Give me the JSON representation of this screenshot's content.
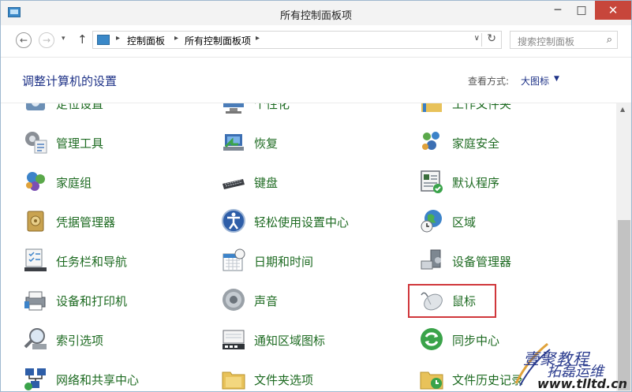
{
  "window": {
    "title": "所有控制面板项",
    "minimize_icon": "minimize-icon",
    "maximize_icon": "maximize-icon",
    "close_icon": "close-icon"
  },
  "navigation": {
    "breadcrumb": [
      "控制面板",
      "所有控制面板项"
    ],
    "search_placeholder": "搜索控制面板"
  },
  "header": {
    "title": "调整计算机的设置",
    "view_label": "查看方式:",
    "view_value": "大图标"
  },
  "items": [
    {
      "label": "定位设置",
      "icon": "location-icon"
    },
    {
      "label": "个性化",
      "icon": "personalization-icon"
    },
    {
      "label": "工作文件夹",
      "icon": "work-folders-icon"
    },
    {
      "label": "管理工具",
      "icon": "admin-tools-icon"
    },
    {
      "label": "恢复",
      "icon": "recovery-icon"
    },
    {
      "label": "家庭安全",
      "icon": "family-safety-icon"
    },
    {
      "label": "家庭组",
      "icon": "homegroup-icon"
    },
    {
      "label": "键盘",
      "icon": "keyboard-icon"
    },
    {
      "label": "默认程序",
      "icon": "default-programs-icon"
    },
    {
      "label": "凭据管理器",
      "icon": "credential-manager-icon"
    },
    {
      "label": "轻松使用设置中心",
      "icon": "ease-of-access-icon"
    },
    {
      "label": "区域",
      "icon": "region-icon"
    },
    {
      "label": "任务栏和导航",
      "icon": "taskbar-icon"
    },
    {
      "label": "日期和时间",
      "icon": "date-time-icon"
    },
    {
      "label": "设备管理器",
      "icon": "device-manager-icon"
    },
    {
      "label": "设备和打印机",
      "icon": "printer-icon"
    },
    {
      "label": "声音",
      "icon": "sound-icon"
    },
    {
      "label": "鼠标",
      "icon": "mouse-icon"
    },
    {
      "label": "索引选项",
      "icon": "indexing-icon"
    },
    {
      "label": "通知区域图标",
      "icon": "notification-icon"
    },
    {
      "label": "同步中心",
      "icon": "sync-center-icon"
    },
    {
      "label": "网络和共享中心",
      "icon": "network-icon"
    },
    {
      "label": "文件夹选项",
      "icon": "folder-options-icon"
    },
    {
      "label": "文件历史记录",
      "icon": "file-history-icon"
    }
  ],
  "watermark": {
    "line1": "壹聚教程",
    "line2": "拓磊运维",
    "url": "www.tlltd.cn"
  }
}
